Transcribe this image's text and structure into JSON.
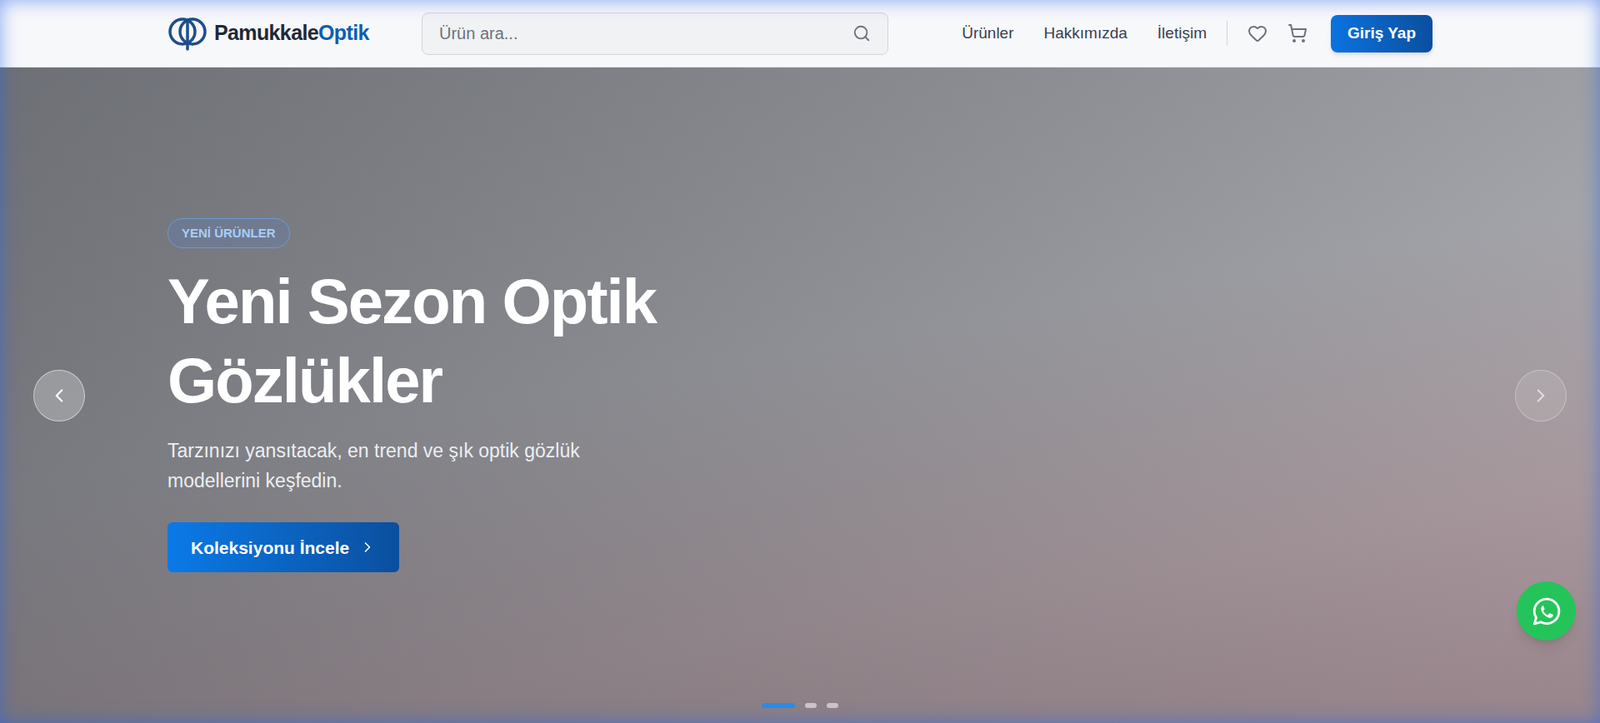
{
  "header": {
    "logo": {
      "first": "Pamukkale",
      "second": "Optik"
    },
    "search": {
      "placeholder": "Ürün ara..."
    },
    "nav": [
      "Ürünler",
      "Hakkımızda",
      "İletişim"
    ],
    "login_button": "Giriş Yap"
  },
  "hero": {
    "badge": "YENİ ÜRÜNLER",
    "title": "Yeni Sezon Optik Gözlükler",
    "subtitle": "Tarzınızı yansıtacak, en trend ve şık optik gözlük modellerini keşfedin.",
    "cta": "Koleksiyonu İncele",
    "arrows": [
      {
        "direction": "prev",
        "highlighted": true
      },
      {
        "direction": "next",
        "highlighted": false
      }
    ],
    "dots": [
      {
        "selected": true
      },
      {
        "selected": false
      },
      {
        "selected": false
      }
    ]
  }
}
